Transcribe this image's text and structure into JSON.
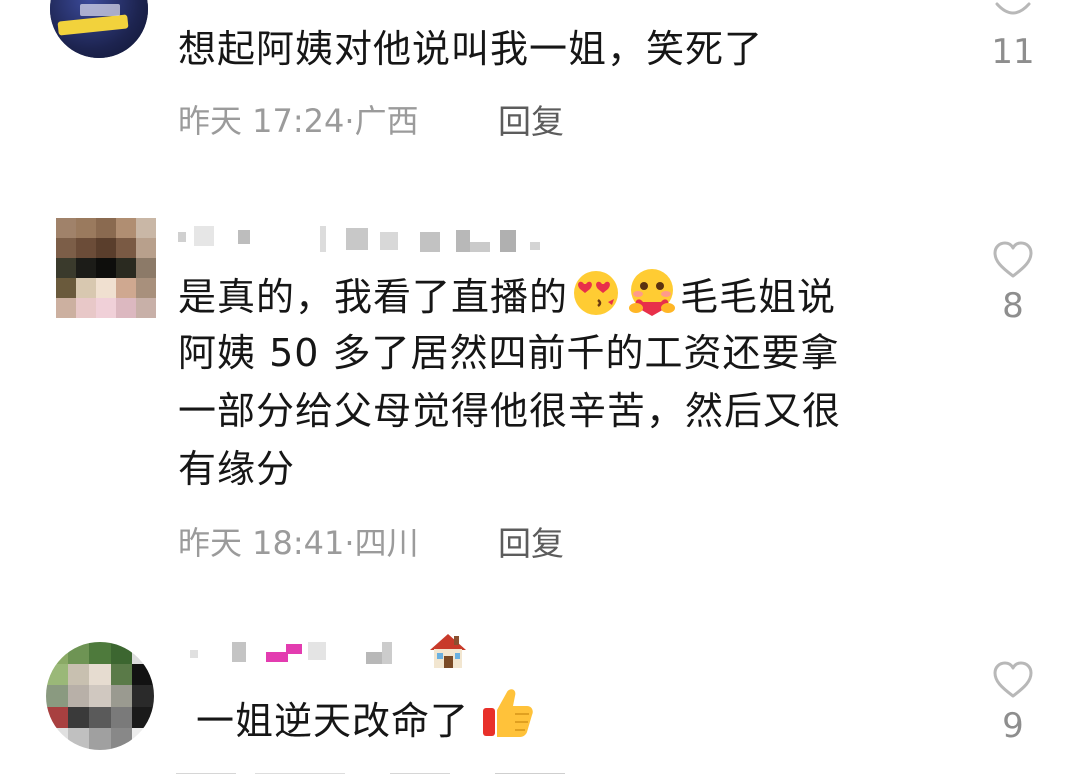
{
  "comments": [
    {
      "text": "想起阿姨对他说叫我一姐，笑死了",
      "time": "昨天 17:24",
      "location": "广西",
      "reply_label": "回复",
      "like_count": "11"
    },
    {
      "text_line_1": "是真的，我看了直播的",
      "text_line_1_tail": "毛毛姐说",
      "text_line_2": "阿姨 50 多了居然四前千的工资还要拿",
      "text_line_3": "一部分给父母觉得他很辛苦，然后又很",
      "text_line_4": "有缘分",
      "time": "昨天 18:41",
      "location": "四川",
      "reply_label": "回复",
      "like_count": "8",
      "emojis": [
        "heart-eyes-kiss-emoji",
        "hugging-heart-emoji"
      ]
    },
    {
      "text": "一姐逆天改命了",
      "like_count": "9",
      "emojis": [
        "house-emoji",
        "thumbs-up-emoji"
      ]
    }
  ],
  "colors": {
    "text": "#161616",
    "meta": "#9b9b9b",
    "reply": "#5c5c5c",
    "heart_outline": "#b8b8b8"
  }
}
